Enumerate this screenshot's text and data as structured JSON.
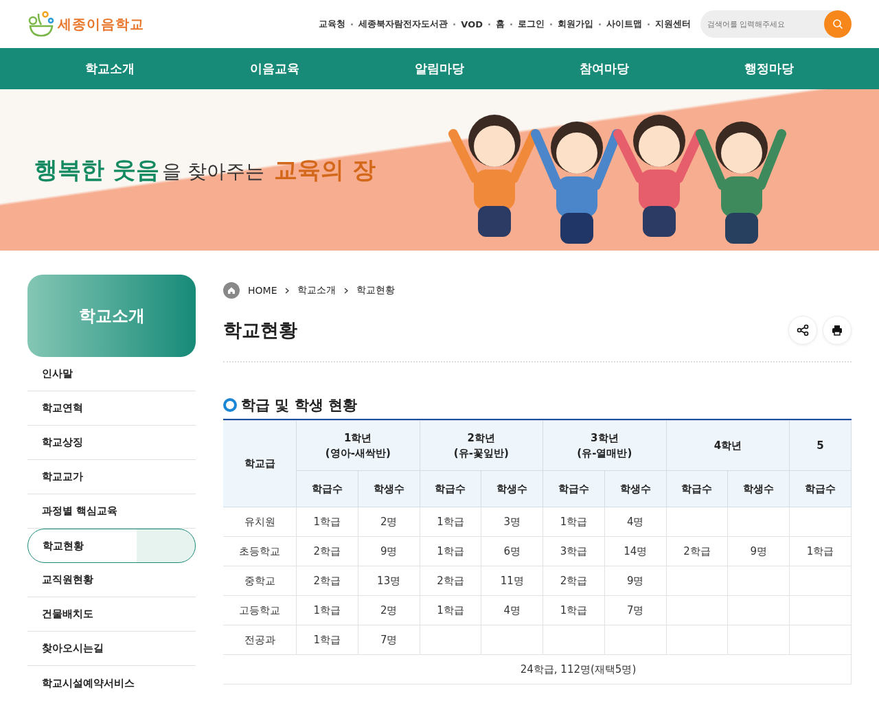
{
  "header": {
    "logo_text": "세종이음학교",
    "links": [
      "교육청",
      "세종북자람전자도서관",
      "VOD",
      "홈",
      "로그인",
      "회원가입",
      "사이트맵",
      "지원센터"
    ],
    "search": {
      "placeholder": "검색어를 입력해주세요"
    }
  },
  "nav": {
    "items": [
      "학교소개",
      "이음교육",
      "알림마당",
      "참여마당",
      "행정마당"
    ]
  },
  "banner": {
    "slogan": [
      {
        "text": "행복한 웃음",
        "kind": "strong"
      },
      {
        "text": "을 찾아주는",
        "kind": "plain"
      },
      {
        "text": "교육의 장",
        "kind": "accent"
      }
    ]
  },
  "sidebar": {
    "title": "학교소개",
    "items": [
      {
        "label": "인사말",
        "selected": false
      },
      {
        "label": "학교연혁",
        "selected": false
      },
      {
        "label": "학교상징",
        "selected": false
      },
      {
        "label": "학교교가",
        "selected": false
      },
      {
        "label": "과정별 핵심교육",
        "selected": false
      },
      {
        "label": "학교현황",
        "selected": true
      },
      {
        "label": "교직원현황",
        "selected": false
      },
      {
        "label": "건물배치도",
        "selected": false
      },
      {
        "label": "찾아오시는길",
        "selected": false
      },
      {
        "label": "학교시설예약서비스",
        "selected": false
      }
    ]
  },
  "breadcrumb": [
    "HOME",
    "학교소개",
    "학교현황"
  ],
  "page_title": "학교현황",
  "section": {
    "title": "학급 및 학생 현황",
    "table": {
      "corner": "학교급",
      "groups": [
        {
          "lines": [
            "1학년",
            "(영아-새싹반)"
          ]
        },
        {
          "lines": [
            "2학년",
            "(유-꽃잎반)"
          ]
        },
        {
          "lines": [
            "3학년",
            "(유-열매반)"
          ]
        },
        {
          "lines": [
            "4학년"
          ]
        },
        {
          "lines": [
            "5"
          ]
        }
      ],
      "sub_columns": [
        "학급수",
        "학생수",
        "학급수",
        "학생수",
        "학급수",
        "학생수",
        "학급수",
        "학생수",
        "학급수"
      ],
      "rows": [
        {
          "school_level": "유치원",
          "cells": [
            "1학급",
            "2명",
            "1학급",
            "3명",
            "1학급",
            "4명",
            null,
            null,
            null
          ]
        },
        {
          "school_level": "초등학교",
          "cells": [
            "2학급",
            "9명",
            "1학급",
            "6명",
            "3학급",
            "14명",
            "2학급",
            "9명",
            "1학급"
          ]
        },
        {
          "school_level": "중학교",
          "cells": [
            "2학급",
            "13명",
            "2학급",
            "11명",
            "2학급",
            "9명",
            null,
            null,
            null
          ]
        },
        {
          "school_level": "고등학교",
          "cells": [
            "1학급",
            "2명",
            "1학급",
            "4명",
            "1학급",
            "7명",
            null,
            null,
            null
          ]
        },
        {
          "school_level": "전공과",
          "cells": [
            "1학급",
            "7명",
            null,
            null,
            null,
            null,
            null,
            null,
            null
          ]
        }
      ],
      "total": "24학급, 112명(재택5명)"
    }
  }
}
